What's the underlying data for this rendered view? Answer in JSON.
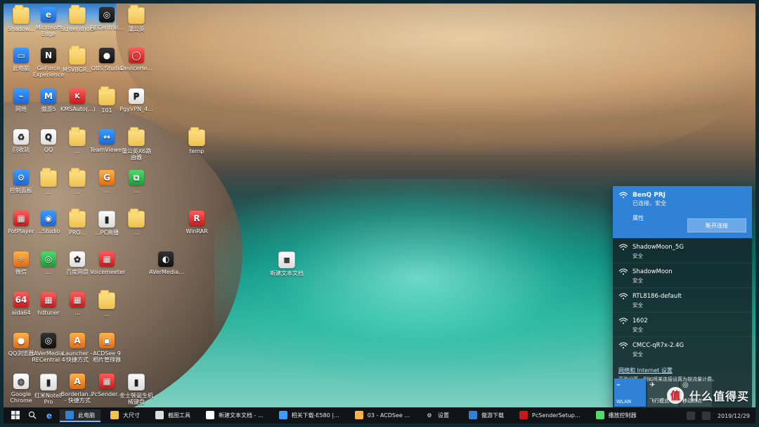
{
  "desktop": {
    "icons": [
      {
        "label": "Shadow...",
        "icon": "folder"
      },
      {
        "label": "Microsoft Edge",
        "icon": "edge-icon"
      },
      {
        "label": "Screenshots",
        "icon": "folder"
      },
      {
        "label": "RECentral...",
        "icon": "app"
      },
      {
        "label": "蒲公英",
        "icon": "folder"
      },
      {
        "label": "此电脑",
        "icon": "computer-icon"
      },
      {
        "label": "GeForce Experience",
        "icon": "nvidia-icon"
      },
      {
        "label": "MSVBGR...",
        "icon": "folder"
      },
      {
        "label": "OBS Studio",
        "icon": "obs-icon"
      },
      {
        "label": "DeviceHe...",
        "icon": "app"
      },
      {
        "label": "网络",
        "icon": "network-icon"
      },
      {
        "label": "傲游5",
        "icon": "maxthon-icon"
      },
      {
        "label": "KMSAuto(...)",
        "icon": "app"
      },
      {
        "label": "101",
        "icon": "folder"
      },
      {
        "label": "PgyVPN_4...",
        "icon": "app"
      },
      {
        "label": "回收站",
        "icon": "recycle-bin-icon"
      },
      {
        "label": "QQ",
        "icon": "qq-icon"
      },
      {
        "label": "...",
        "icon": "folder"
      },
      {
        "label": "TeamViewer",
        "icon": "teamviewer-icon"
      },
      {
        "label": "蒲公英X6路由器",
        "icon": "folder"
      },
      {
        "label": "temp",
        "icon": "folder"
      },
      {
        "label": "控制面板",
        "icon": "control-panel-icon"
      },
      {
        "label": "...",
        "icon": "folder"
      },
      {
        "label": "...",
        "icon": "folder"
      },
      {
        "label": "...",
        "icon": "app"
      },
      {
        "label": "...",
        "icon": "app"
      },
      {
        "label": "PotPlayer",
        "icon": "app"
      },
      {
        "label": "...Studio",
        "icon": "app"
      },
      {
        "label": "PRO...",
        "icon": "folder"
      },
      {
        "label": "...PC直播",
        "icon": "app"
      },
      {
        "label": "...",
        "icon": "app"
      },
      {
        "label": "WinRAR",
        "icon": "winrar-icon"
      },
      {
        "label": "微信",
        "icon": "wechat-icon"
      },
      {
        "label": "...",
        "icon": "app"
      },
      {
        "label": "百度网盘",
        "icon": "app"
      },
      {
        "label": "Voicemeeter",
        "icon": "app"
      },
      {
        "label": "AVerMedia...",
        "icon": "app"
      },
      {
        "label": "新建文本文档",
        "icon": "text-file-icon"
      },
      {
        "label": "aida64",
        "icon": "app"
      },
      {
        "label": "hdtuner",
        "icon": "app"
      },
      {
        "label": "...",
        "icon": "app"
      },
      {
        "label": "...",
        "icon": "folder"
      },
      {
        "label": "QQ浏览器",
        "icon": "app"
      },
      {
        "label": "AVerMedia RECentral 4",
        "icon": "app"
      },
      {
        "label": "Launcher - 快捷方式",
        "icon": "app"
      },
      {
        "label": "ACDSee 9 相片管理器",
        "icon": "app"
      },
      {
        "label": "Google Chrome",
        "icon": "chrome-icon"
      },
      {
        "label": "红米Note8 Pro",
        "icon": "app"
      },
      {
        "label": "Borderlan... - 快捷方式",
        "icon": "app"
      },
      {
        "label": "PcSender...",
        "icon": "app"
      },
      {
        "label": "金士顿诞生机械键盘",
        "icon": "app"
      }
    ]
  },
  "network_flyout": {
    "active": {
      "ssid": "BenQ PRJ",
      "status": "已连接，安全",
      "properties_label": "属性",
      "disconnect_label": "断开连接"
    },
    "networks": [
      {
        "ssid": "ShadowMoon_5G",
        "status": "安全"
      },
      {
        "ssid": "ShadowMoon",
        "status": "安全"
      },
      {
        "ssid": "RTL8186-default",
        "status": "安全"
      },
      {
        "ssid": "1602",
        "status": "安全"
      },
      {
        "ssid": "CMCC-qR7x-2.4G",
        "status": "安全"
      }
    ],
    "settings_link": "网络和 Internet 设置",
    "settings_desc": "更改设置，例如将某连接设置为按流量计费。",
    "quick_actions": [
      {
        "label": "WLAN",
        "icon": "wifi-icon",
        "on": true
      },
      {
        "label": "飞行模式",
        "icon": "airplane-icon",
        "on": false
      },
      {
        "label": "移动热点",
        "icon": "hotspot-icon",
        "on": false
      }
    ]
  },
  "taskbar": {
    "items": [
      {
        "label": "此电脑"
      },
      {
        "label": "大尺寸"
      },
      {
        "label": "截图工具"
      },
      {
        "label": "新建文本文档 - ..."
      },
      {
        "label": "相关下载-E580 |..."
      },
      {
        "label": "03 - ACDSee ..."
      },
      {
        "label": "设置"
      },
      {
        "label": "傲游下载"
      },
      {
        "label": "PcSenderSetup..."
      },
      {
        "label": "播放控制器"
      }
    ],
    "date": "2019/12/29"
  },
  "watermark": {
    "text": "什么值得买",
    "badge": "值"
  }
}
